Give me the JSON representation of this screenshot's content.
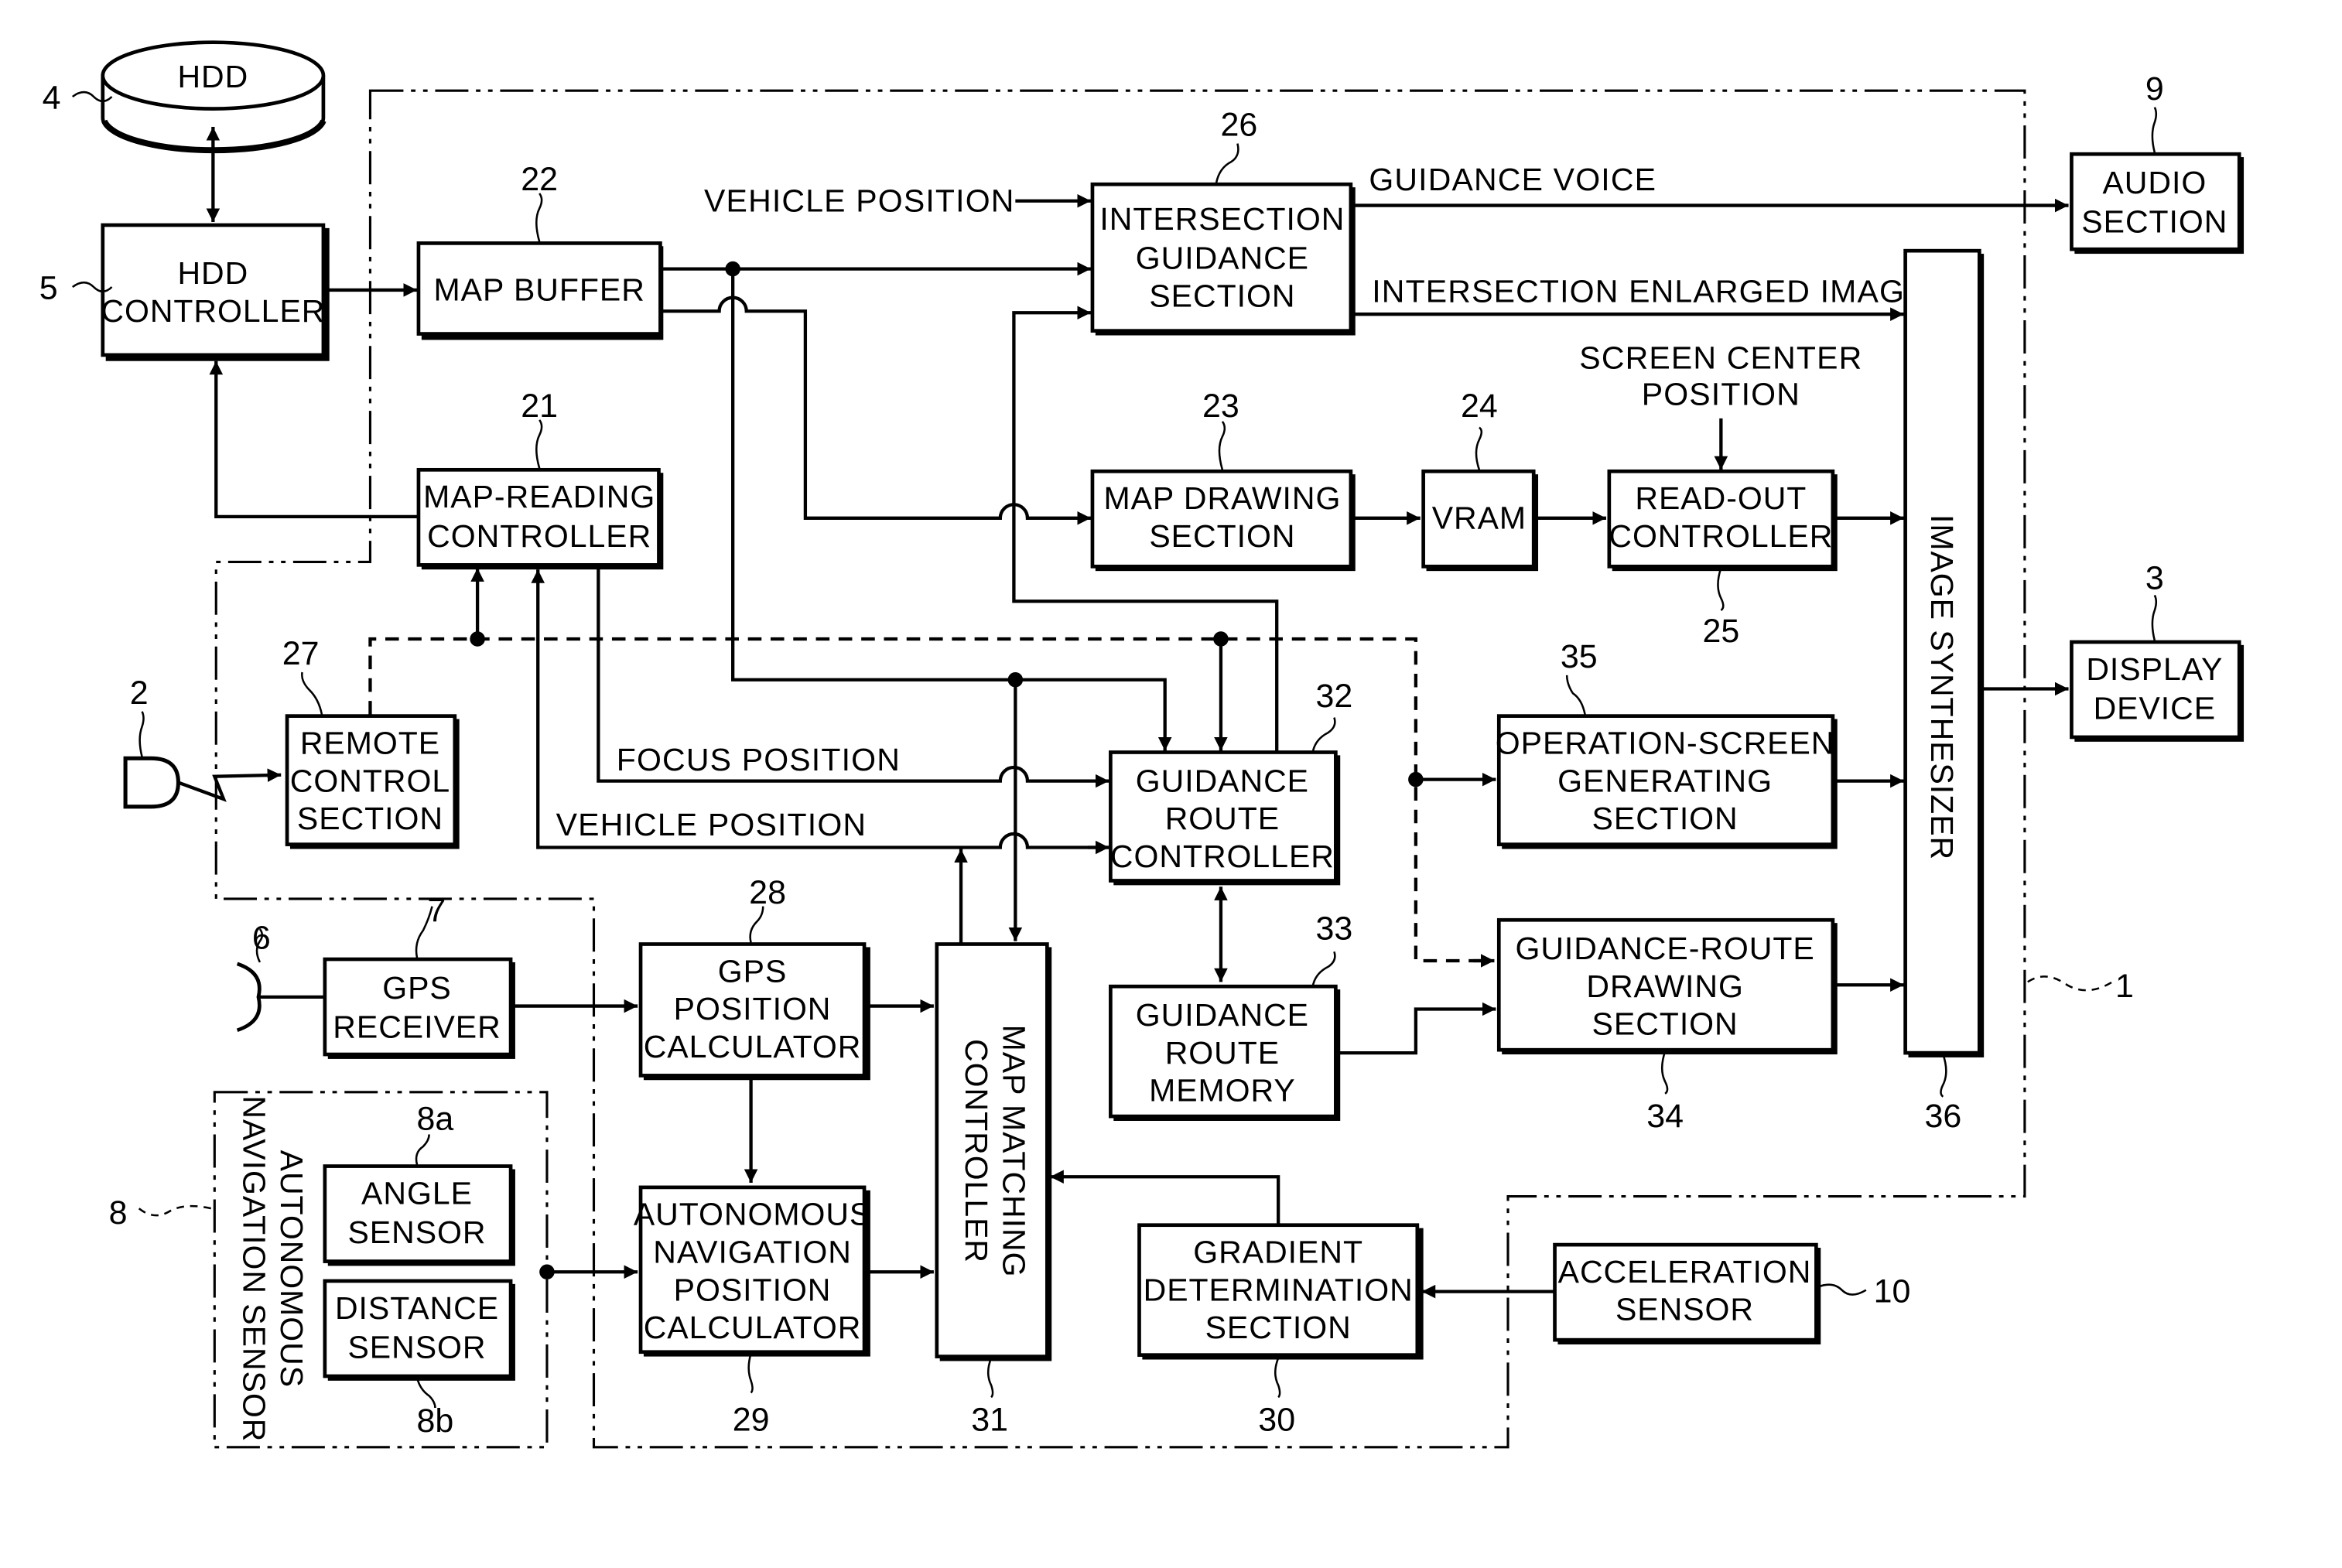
{
  "figure": {
    "boundary_ref": "1",
    "blocks": {
      "hdd": {
        "ref": "4",
        "lines": [
          "HDD"
        ]
      },
      "hdd_controller": {
        "ref": "5",
        "lines": [
          "HDD",
          "CONTROLLER"
        ]
      },
      "map_buffer": {
        "ref": "22",
        "lines": [
          "MAP BUFFER"
        ]
      },
      "map_reading_controller": {
        "ref": "21",
        "lines": [
          "MAP-READING",
          "CONTROLLER"
        ]
      },
      "intersection_guidance": {
        "ref": "26",
        "lines": [
          "INTERSECTION",
          "GUIDANCE",
          "SECTION"
        ]
      },
      "map_drawing": {
        "ref": "23",
        "lines": [
          "MAP DRAWING",
          "SECTION"
        ]
      },
      "vram": {
        "ref": "24",
        "lines": [
          "VRAM"
        ]
      },
      "readout_controller": {
        "ref": "25",
        "lines": [
          "READ-OUT",
          "CONTROLLER"
        ]
      },
      "audio_section": {
        "ref": "9",
        "lines": [
          "AUDIO",
          "SECTION"
        ]
      },
      "display_device": {
        "ref": "3",
        "lines": [
          "DISPLAY",
          "DEVICE"
        ]
      },
      "image_synthesizer": {
        "ref": "36",
        "lines": [
          "IMAGE SYNTHESIZER"
        ]
      },
      "remote_control": {
        "ref": "27",
        "lines": [
          "REMOTE",
          "CONTROL",
          "SECTION"
        ]
      },
      "remote_unit": {
        "ref": "2"
      },
      "guidance_route_controller": {
        "ref": "32",
        "lines": [
          "GUIDANCE",
          "ROUTE",
          "CONTROLLER"
        ]
      },
      "guidance_route_memory": {
        "ref": "33",
        "lines": [
          "GUIDANCE",
          "ROUTE",
          "MEMORY"
        ]
      },
      "operation_screen": {
        "ref": "35",
        "lines": [
          "OPERATION-SCREEN",
          "GENERATING",
          "SECTION"
        ]
      },
      "guidance_route_drawing": {
        "ref": "34",
        "lines": [
          "GUIDANCE-ROUTE",
          "DRAWING",
          "SECTION"
        ]
      },
      "gps_antenna": {
        "ref": "6"
      },
      "gps_receiver": {
        "ref": "7",
        "lines": [
          "GPS",
          "RECEIVER"
        ]
      },
      "gps_position_calc": {
        "ref": "28",
        "lines": [
          "GPS",
          "POSITION",
          "CALCULATOR"
        ]
      },
      "auto_nav_position_calc": {
        "ref": "29",
        "lines": [
          "AUTONOMOUS",
          "NAVIGATION",
          "POSITION",
          "CALCULATOR"
        ]
      },
      "map_matching_controller": {
        "ref": "31",
        "lines": [
          "MAP MATCHING",
          "CONTROLLER"
        ]
      },
      "gradient_determination": {
        "ref": "30",
        "lines": [
          "GRADIENT",
          "DETERMINATION",
          "SECTION"
        ]
      },
      "acceleration_sensor": {
        "ref": "10",
        "lines": [
          "ACCELERATION",
          "SENSOR"
        ]
      },
      "auto_nav_sensor": {
        "ref": "8",
        "lines": [
          "AUTONOMOUS",
          "NAVIGATION SENSOR"
        ]
      },
      "angle_sensor": {
        "ref": "8a",
        "lines": [
          "ANGLE",
          "SENSOR"
        ]
      },
      "distance_sensor": {
        "ref": "8b",
        "lines": [
          "DISTANCE",
          "SENSOR"
        ]
      }
    },
    "signals": {
      "vehicle_position_top": "VEHICLE POSITION",
      "guidance_voice": "GUIDANCE VOICE",
      "intersection_enlarged_image": "INTERSECTION ENLARGED IMAGE",
      "screen_center_position": [
        "SCREEN CENTER",
        "POSITION"
      ],
      "focus_position": "FOCUS POSITION",
      "vehicle_position_mid": "VEHICLE POSITION"
    }
  }
}
